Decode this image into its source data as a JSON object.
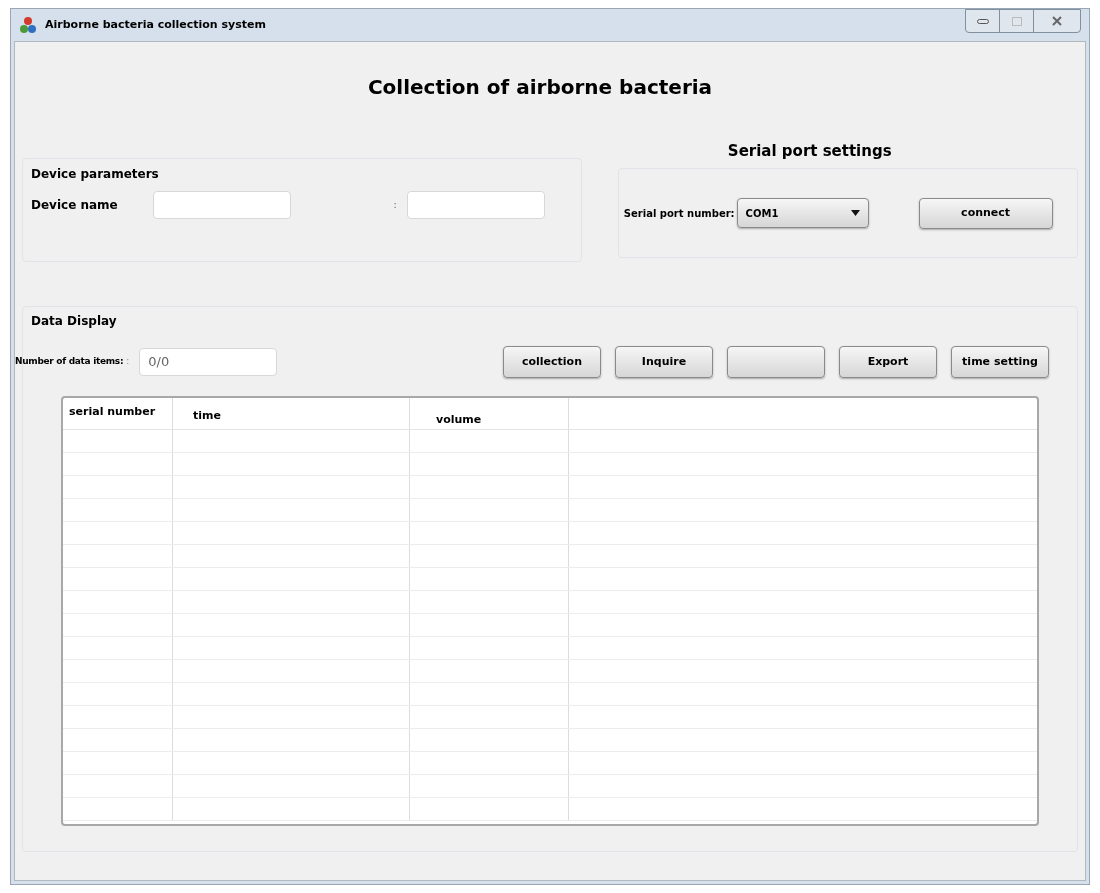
{
  "window": {
    "title": "Airborne bacteria collection system"
  },
  "heading": "Collection of airborne bacteria",
  "device_parameters": {
    "title": "Device parameters",
    "label": "Device name",
    "separator": ":"
  },
  "serial_port": {
    "title": "Serial port settings",
    "label": "Serial port number:",
    "value": "COM1",
    "button": "connect"
  },
  "data_display": {
    "title": "Data Display",
    "count_label": "Number of data items:",
    "count_separator": ":",
    "count_value": "0/0",
    "buttons": [
      {
        "kind": "text",
        "label": "collection"
      },
      {
        "kind": "text",
        "label": "Inquire"
      },
      {
        "kind": "blank"
      },
      {
        "kind": "text",
        "label": "Export"
      },
      {
        "kind": "text",
        "label": "time setting"
      }
    ]
  },
  "table": {
    "columns": [
      "serial number",
      "time",
      "volume"
    ]
  }
}
